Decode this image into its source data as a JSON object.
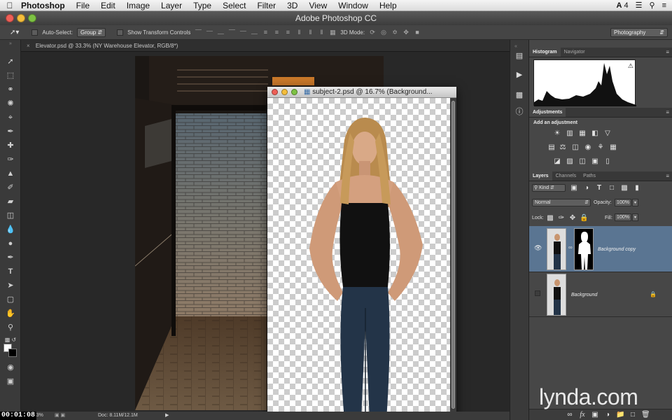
{
  "menubar": {
    "app_name": "Photoshop",
    "items": [
      "File",
      "Edit",
      "Image",
      "Layer",
      "Type",
      "Select",
      "Filter",
      "3D",
      "View",
      "Window",
      "Help"
    ],
    "status_count": "4"
  },
  "window": {
    "title": "Adobe Photoshop CC"
  },
  "options": {
    "auto_select_label": "Auto-Select:",
    "auto_select_value": "Group",
    "transform_controls_label": "Show Transform Controls",
    "mode_3d_label": "3D Mode:",
    "workspace": "Photography"
  },
  "document": {
    "tab_title": "Elevator.psd @ 33.3% (NY Warehouse Elevator, RGB/8*)",
    "zoom": "33.3%",
    "doc_size": "Doc: 8.11M/12.1M",
    "timecode": "00:01:08"
  },
  "subject_window": {
    "title": "subject-2.psd @ 16.7% (Background..."
  },
  "panels": {
    "histogram": {
      "tabs": [
        "Histogram",
        "Navigator"
      ]
    },
    "adjustments": {
      "tab": "Adjustments",
      "heading": "Add an adjustment"
    },
    "layers": {
      "tabs": [
        "Layers",
        "Channels",
        "Paths"
      ],
      "filter_kind": "Kind",
      "blend_mode": "Normal",
      "opacity_label": "Opacity:",
      "opacity_value": "100%",
      "lock_label": "Lock:",
      "fill_label": "Fill:",
      "fill_value": "100%",
      "items": [
        {
          "name": "Background copy",
          "visible": true,
          "selected": true,
          "has_mask": true
        },
        {
          "name": "Background",
          "visible": false,
          "selected": false,
          "locked": true
        }
      ]
    }
  },
  "watermark": "lynda.com",
  "colors": {
    "selected_layer": "#5a7592",
    "panel_bg": "#474747",
    "canvas_bg": "#282828"
  }
}
